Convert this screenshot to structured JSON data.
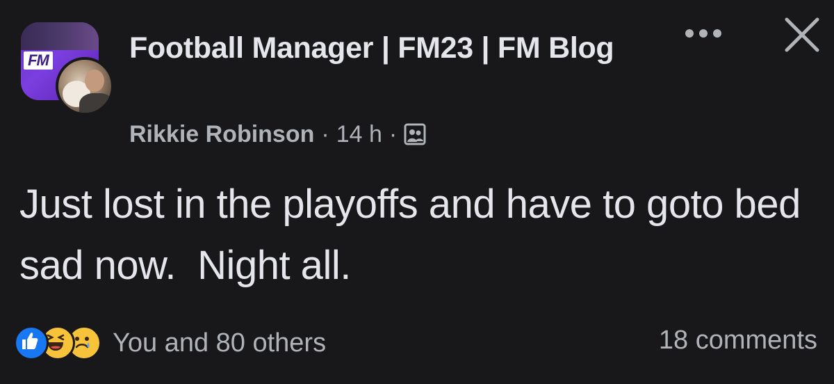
{
  "post": {
    "group_name": "Football Manager | FM23 | FM Blog",
    "group_logo_text": "FM",
    "author": "Rikkie Robinson",
    "separator": "·",
    "timestamp": "14 h",
    "audience_icon": "group-audience-icon",
    "text": "Just lost in the playoffs and have to goto bed sad now.  Night all.",
    "reactions": {
      "types": [
        "like",
        "haha",
        "sad"
      ],
      "label": "You and 80 others"
    },
    "comments_label": "18 comments",
    "actions": {
      "more_icon": "more-options-icon",
      "close_icon": "close-icon"
    }
  },
  "colors": {
    "background": "#18181a",
    "primary_text": "#e4e6eb",
    "secondary_text": "#b0b3b8",
    "like_blue": "#1877f2",
    "emoji_yellow": "#f7c33b"
  }
}
